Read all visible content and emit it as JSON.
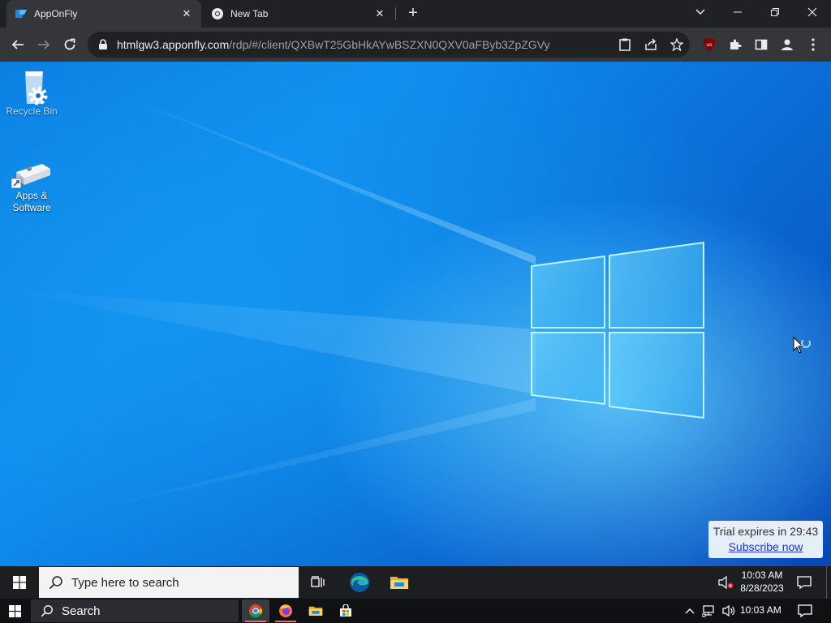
{
  "browser": {
    "tabs": [
      {
        "title": "AppOnFly",
        "favicon": "apponfly-logo-icon",
        "active": true
      },
      {
        "title": "New Tab",
        "favicon": "chrome-icon",
        "active": false
      }
    ],
    "address": {
      "host": "htmlgw3.apponfly.com",
      "path": "/rdp/#/client/QXBwT25GbHkAYwBSZXN0QXV0aFByb3ZpZGVy"
    },
    "accent_colors": {
      "tabstrip": "#202124",
      "toolbar": "#35363a",
      "ublock": "#800000"
    }
  },
  "desktop": {
    "icons": [
      {
        "label": "Recycle Bin",
        "icon": "recycle-bin-icon",
        "overlay": "gear-icon"
      },
      {
        "label": "Apps &\nSoftware",
        "label_line1": "Apps &",
        "label_line2": "Software",
        "icon": "apps-software-drive-icon"
      }
    ],
    "trial": {
      "text": "Trial expires in 29:43",
      "link": "Subscribe now"
    },
    "wallpaper": "windows-10-hero",
    "cursor": "busy-pointer-icon"
  },
  "remote_taskbar": {
    "search_placeholder": "Type here to search",
    "time": "10:03 AM",
    "date": "8/28/2023",
    "apps": [
      "task-view-icon",
      "edge-icon",
      "file-explorer-icon"
    ]
  },
  "local_taskbar": {
    "search_label": "Search",
    "time": "10:03 AM",
    "apps": [
      "chrome-icon",
      "firefox-icon",
      "file-explorer-icon",
      "store-icon"
    ]
  }
}
